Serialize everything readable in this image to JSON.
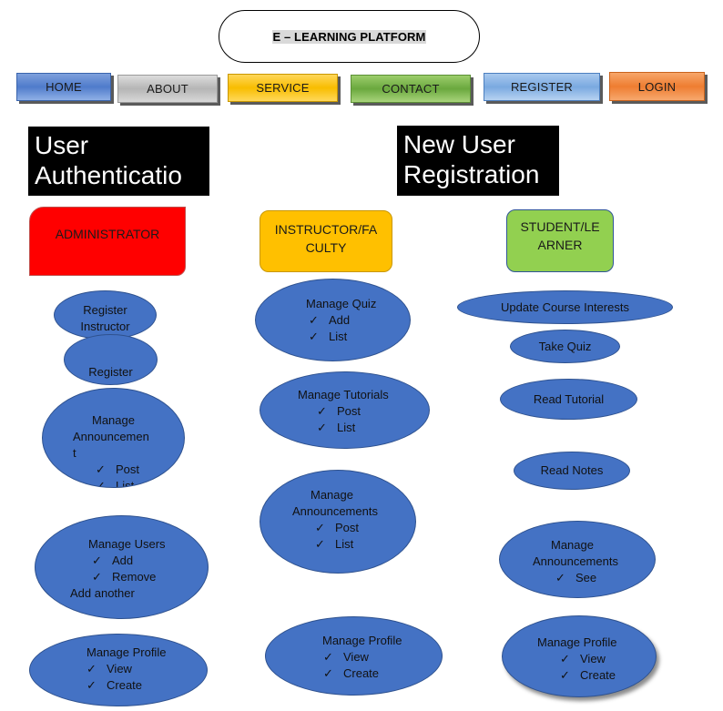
{
  "title": "E – LEARNING PLATFORM",
  "nav": [
    {
      "label": "HOME",
      "color": "#4f7bcb"
    },
    {
      "label": "ABOUT",
      "color": "#b5b5b5"
    },
    {
      "label": "SERVICE",
      "color": "#f8bd00"
    },
    {
      "label": "CONTACT",
      "color": "#6aa83e"
    },
    {
      "label": "REGISTER",
      "color": "#7aa9e0"
    },
    {
      "label": "LOGIN",
      "color": "#ee7d31"
    }
  ],
  "headers": {
    "auth": "User\nAuthenticatio",
    "registration": "New User\nRegistration"
  },
  "roles": {
    "admin": {
      "label": "ADMINISTRATOR",
      "color": "#ff0000"
    },
    "instructor": {
      "label_line1": "INSTRUCTOR/FA",
      "label_line2": "CULTY",
      "color": "#ffc000"
    },
    "student": {
      "label_line1": "STUDENT/LE",
      "label_line2": "ARNER",
      "color": "#92d050"
    }
  },
  "check_mark": "✓",
  "admin_actions": {
    "register_instructor": {
      "line1": "Register",
      "line2": "Instructor"
    },
    "register": {
      "label": "Register"
    },
    "manage_announcements": {
      "line1": "Manage",
      "line2": "Announcemen",
      "line3": "t",
      "items": [
        "Post",
        "List"
      ]
    },
    "manage_users": {
      "title": "Manage Users",
      "items": [
        "Add",
        "Remove"
      ],
      "extra": "Add another"
    },
    "manage_profile": {
      "title": "Manage Profile",
      "items": [
        "View",
        "Create"
      ]
    }
  },
  "instructor_actions": {
    "manage_quiz": {
      "title": "Manage Quiz",
      "items": [
        "Add",
        "List"
      ]
    },
    "manage_tutorials": {
      "title": "Manage Tutorials",
      "items": [
        "Post",
        "List"
      ]
    },
    "manage_announcements": {
      "line1": "Manage",
      "line2": "Announcements",
      "items": [
        "Post",
        "List"
      ]
    },
    "manage_profile": {
      "title": "Manage Profile",
      "items": [
        "View",
        "Create"
      ]
    }
  },
  "student_actions": {
    "update_course_interests": {
      "label": "Update Course Interests"
    },
    "take_quiz": {
      "label": "Take Quiz"
    },
    "read_tutorial": {
      "label": "Read Tutorial"
    },
    "read_notes": {
      "label": "Read Notes"
    },
    "manage_announcements": {
      "line1": "Manage",
      "line2": "Announcements",
      "items": [
        "See"
      ]
    },
    "manage_profile": {
      "title": "Manage Profile",
      "items": [
        "View",
        "Create"
      ]
    }
  },
  "colors": {
    "ellipse_fill": "#4472c4",
    "ellipse_stroke": "#2f528f",
    "title_highlight": "#d9d9d9"
  }
}
